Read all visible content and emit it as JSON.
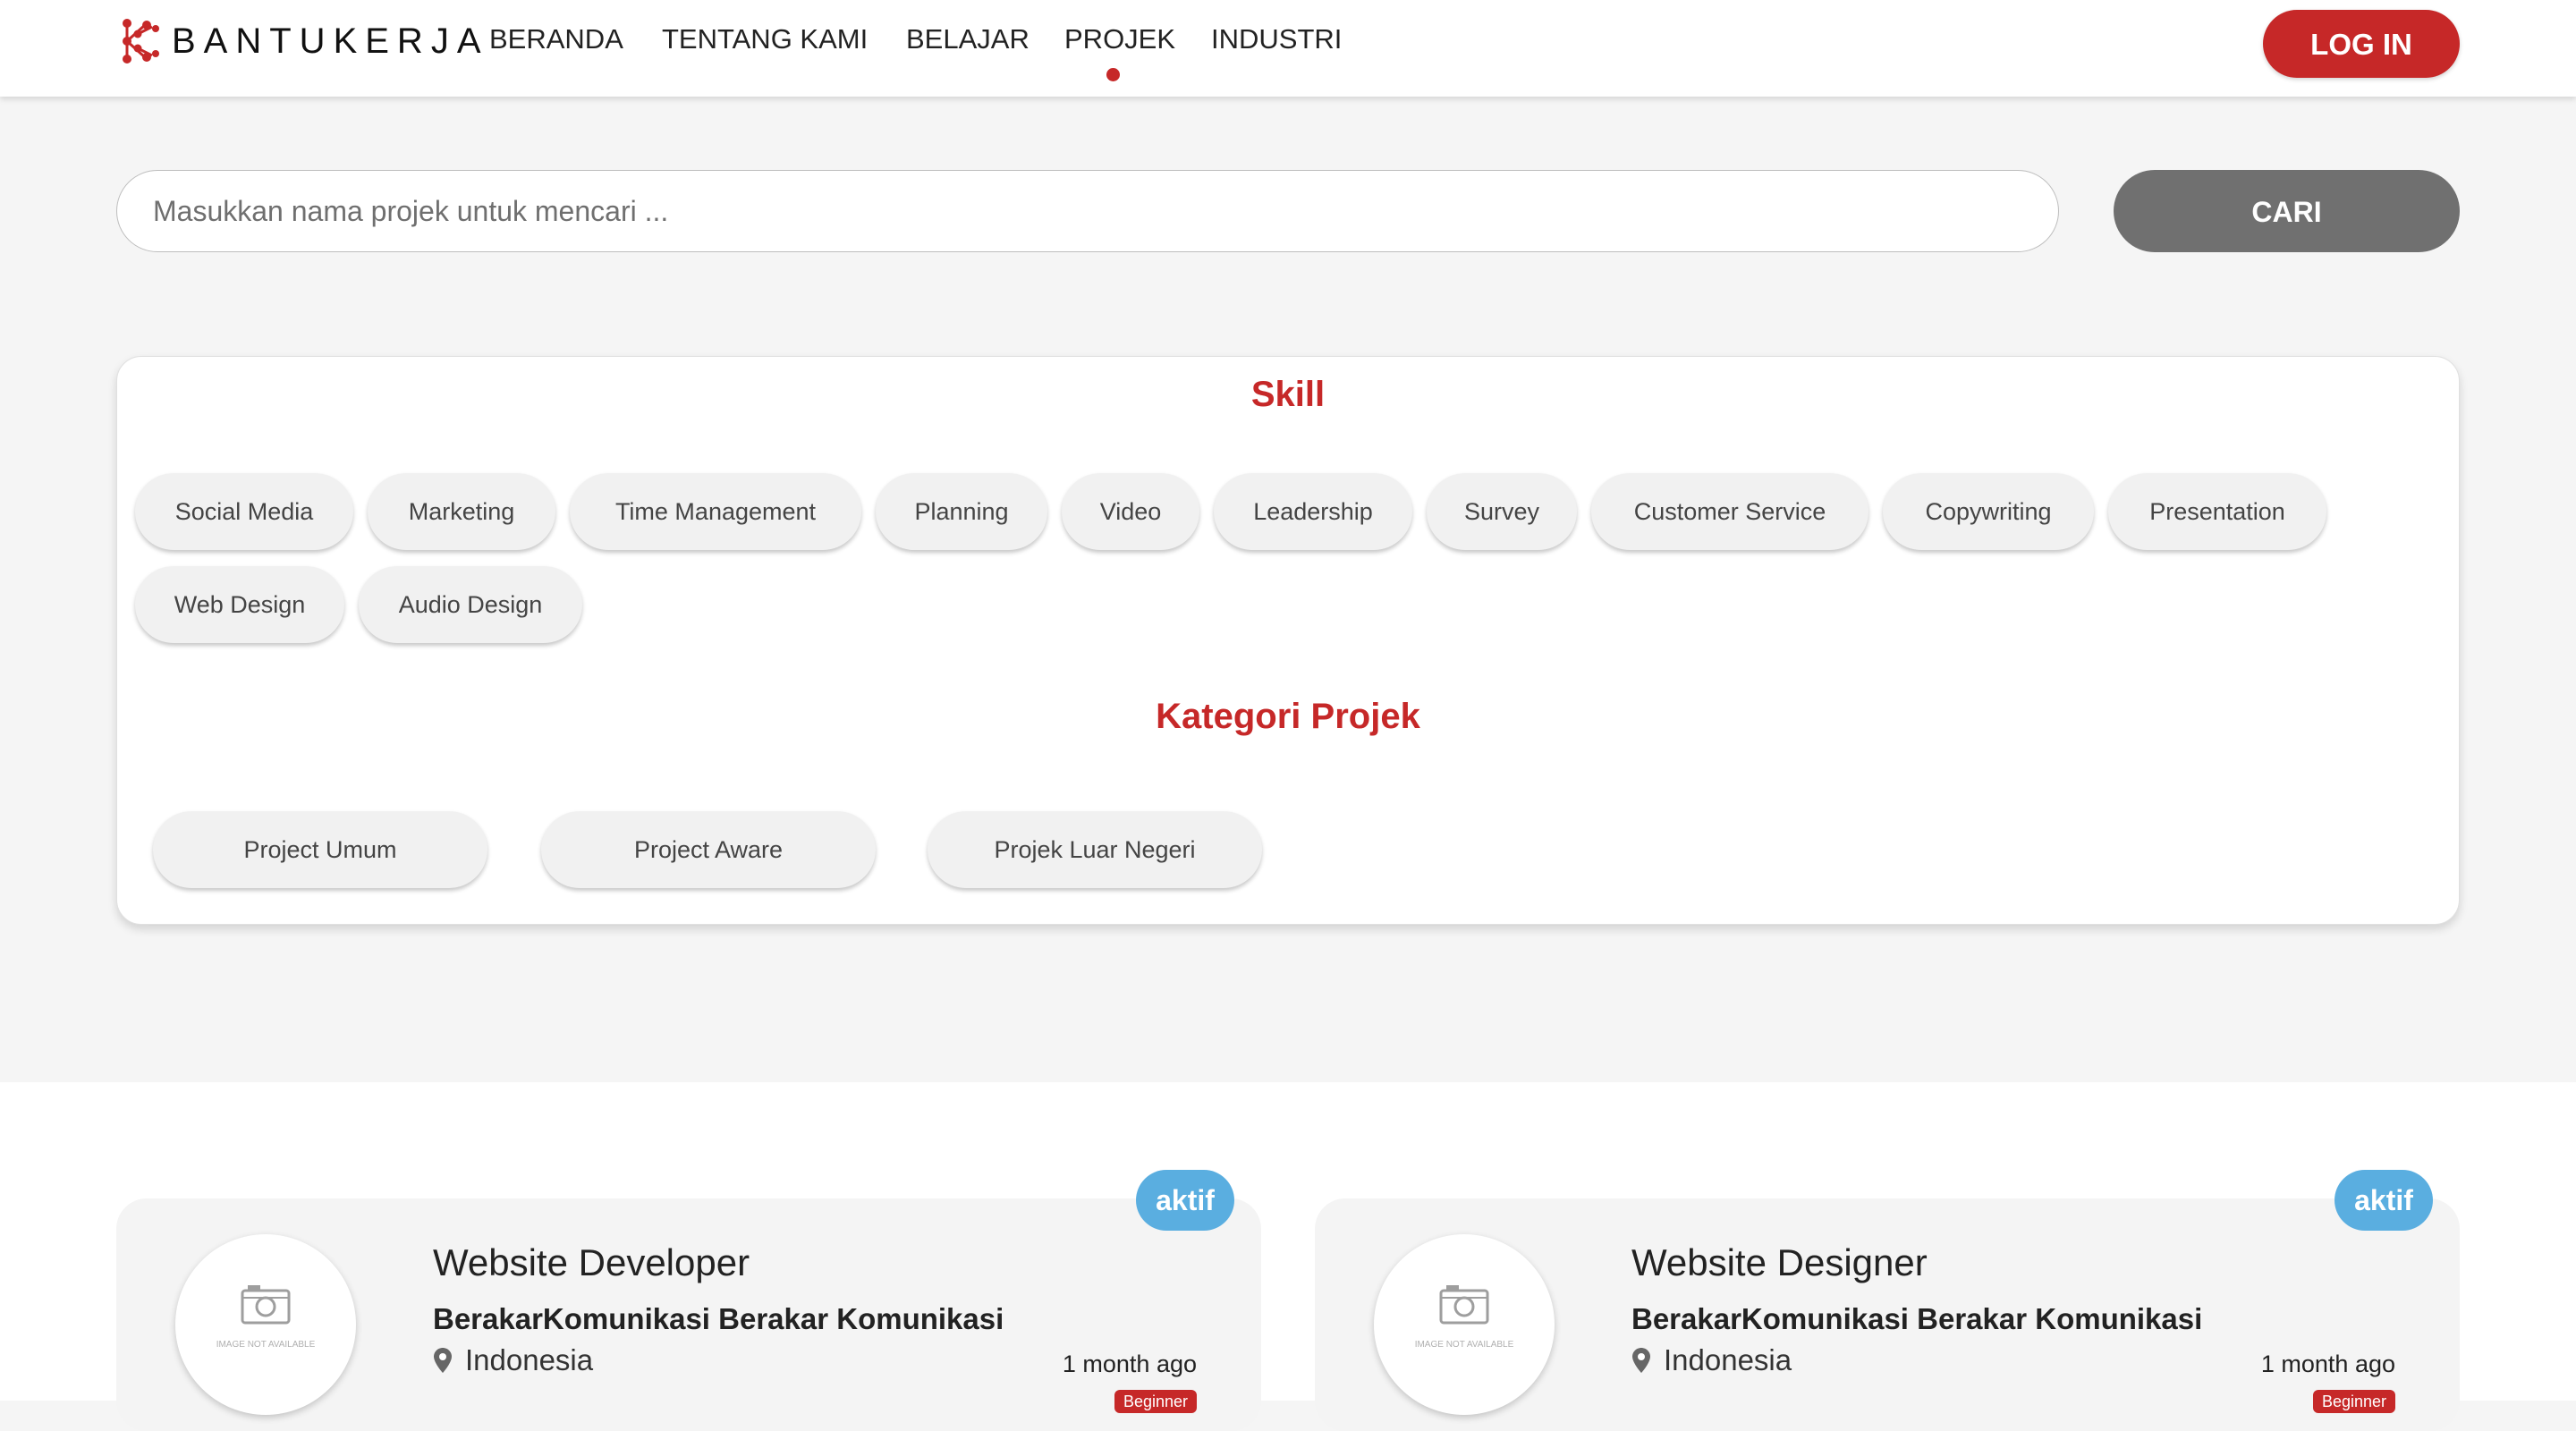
{
  "header": {
    "logo_text": "BANTUKERJA",
    "nav": [
      {
        "label": "BERANDA"
      },
      {
        "label": "TENTANG KAMI"
      },
      {
        "label": "BELAJAR"
      },
      {
        "label": "PROJEK",
        "active": true
      },
      {
        "label": "INDUSTRI"
      }
    ],
    "login_label": "LOG IN"
  },
  "search": {
    "placeholder": "Masukkan nama projek untuk mencari ...",
    "button_label": "CARI"
  },
  "filters": {
    "skill_title": "Skill",
    "skills": [
      "Social Media",
      "Marketing",
      "Time Management",
      "Planning",
      "Video",
      "Leadership",
      "Survey",
      "Customer Service",
      "Copywriting",
      "Presentation",
      "Web Design",
      "Audio Design"
    ],
    "category_title": "Kategori Projek",
    "categories": [
      "Project Umum",
      "Project Aware",
      "Projek Luar Negeri"
    ]
  },
  "projects": [
    {
      "status": "aktif",
      "image_text": "IMAGE NOT AVAILABLE",
      "title": "Website Developer",
      "company": "BerakarKomunikasi Berakar Komunikasi",
      "location": "Indonesia",
      "posted": "1 month ago",
      "level": "Beginner"
    },
    {
      "status": "aktif",
      "image_text": "IMAGE NOT AVAILABLE",
      "title": "Website Designer",
      "company": "BerakarKomunikasi Berakar Komunikasi",
      "location": "Indonesia",
      "posted": "1 month ago",
      "level": "Beginner"
    }
  ],
  "colors": {
    "brand_red": "#c62828",
    "search_button": "#707070",
    "status_badge": "#5aaee0"
  }
}
